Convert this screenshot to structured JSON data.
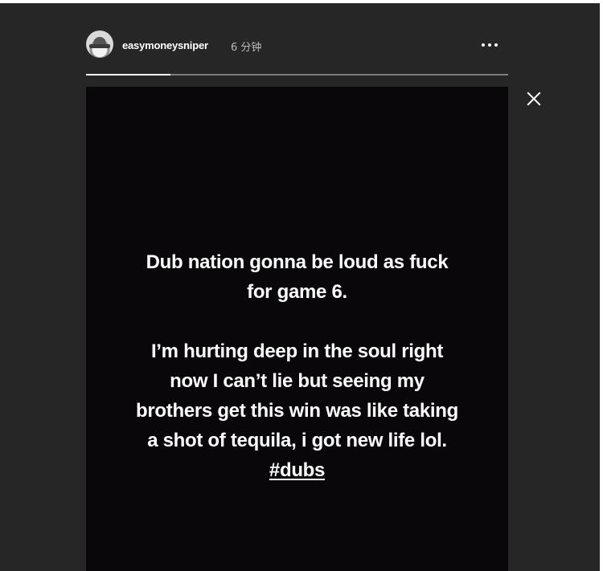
{
  "header": {
    "username": "easymoneysniper",
    "timestamp": "6 分钟",
    "avatar_icon": "user-avatar"
  },
  "story": {
    "progress": 0.2,
    "paragraph_1": {
      "line_1": "Dub nation gonna be loud as fuck",
      "line_2": "for game 6."
    },
    "paragraph_2": {
      "line_1": "I’m hurting deep in the soul right",
      "line_2": "now I can’t lie but seeing my",
      "line_3": "brothers get this win was like taking",
      "line_4": "a shot of tequila, i got new life lol."
    },
    "hashtag": "#dubs"
  },
  "controls": {
    "more_icon": "ellipsis-icon",
    "close_icon": "close-icon"
  },
  "colors": {
    "page_background": "#262626",
    "story_background": "#090709",
    "text": "#ffffff",
    "progress_track": "#7d7d7d",
    "progress_fill": "#ffffff"
  }
}
